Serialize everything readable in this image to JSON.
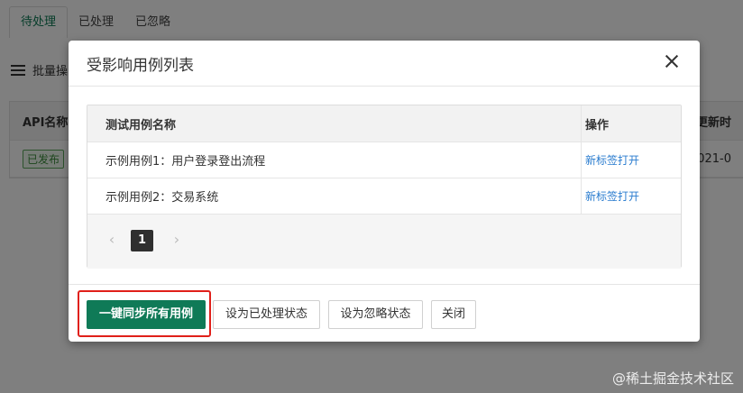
{
  "background": {
    "tabs": [
      "待处理",
      "已处理",
      "已忽略"
    ],
    "bulk_label": "批量操",
    "table": {
      "col_api": "API名称",
      "col_updated": "更新时",
      "row_status": "已发布",
      "row_updated": "2021-0"
    }
  },
  "modal": {
    "title": "受影响用例列表",
    "table": {
      "headers": {
        "name": "测试用例名称",
        "action": "操作"
      },
      "rows": [
        {
          "name": "示例用例1：用户登录登出流程",
          "action": "新标签打开"
        },
        {
          "name": "示例用例2：交易系统",
          "action": "新标签打开"
        }
      ]
    },
    "pagination": {
      "prev": "‹",
      "current": "1",
      "next": "›"
    },
    "buttons": {
      "sync_all": "一键同步所有用例",
      "mark_processed": "设为已处理状态",
      "mark_ignored": "设为忽略状态",
      "close": "关闭"
    }
  },
  "watermark": "@稀土掘金技术社区"
}
